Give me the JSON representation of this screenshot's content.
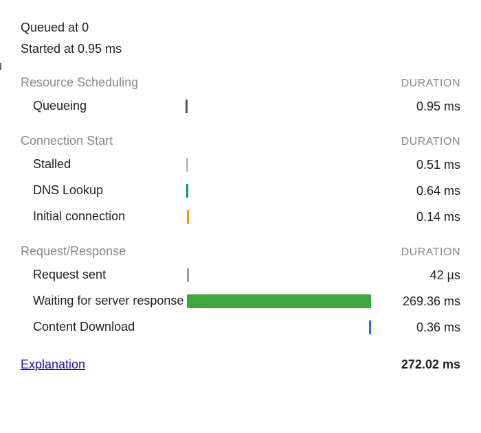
{
  "top": {
    "queued": "Queued at 0",
    "started": "Started at 0.95 ms"
  },
  "duration_label": "DURATION",
  "sections": {
    "resource_scheduling": {
      "title": "Resource Scheduling",
      "rows": {
        "queueing": {
          "label": "Queueing",
          "value": "0.95 ms"
        }
      }
    },
    "connection_start": {
      "title": "Connection Start",
      "rows": {
        "stalled": {
          "label": "Stalled",
          "value": "0.51 ms"
        },
        "dns_lookup": {
          "label": "DNS Lookup",
          "value": "0.64 ms"
        },
        "initial_connection": {
          "label": "Initial connection",
          "value": "0.14 ms"
        }
      }
    },
    "request_response": {
      "title": "Request/Response",
      "rows": {
        "request_sent": {
          "label": "Request sent",
          "value": "42 µs"
        },
        "waiting": {
          "label": "Waiting for server response",
          "value": "269.36 ms"
        },
        "content_download": {
          "label": "Content Download",
          "value": "0.36 ms"
        }
      }
    }
  },
  "footer": {
    "explanation": "Explanation",
    "total": "272.02 ms"
  },
  "chart_data": {
    "type": "bar",
    "total_ms": 272.02,
    "phases": [
      {
        "name": "Queueing",
        "start_ms": 0.0,
        "duration_ms": 0.95,
        "color": "#555555"
      },
      {
        "name": "Stalled",
        "start_ms": 0.95,
        "duration_ms": 0.51,
        "color": "#bdbdbd"
      },
      {
        "name": "DNS Lookup",
        "start_ms": 1.46,
        "duration_ms": 0.64,
        "color": "#009688"
      },
      {
        "name": "Initial connection",
        "start_ms": 2.1,
        "duration_ms": 0.14,
        "color": "#ff9800"
      },
      {
        "name": "Request sent",
        "start_ms": 2.24,
        "duration_ms": 0.042,
        "color": "#9e9e9e"
      },
      {
        "name": "Waiting for server response",
        "start_ms": 2.28,
        "duration_ms": 269.36,
        "color": "#3fa640"
      },
      {
        "name": "Content Download",
        "start_ms": 271.64,
        "duration_ms": 0.36,
        "color": "#1a73e8"
      }
    ]
  }
}
